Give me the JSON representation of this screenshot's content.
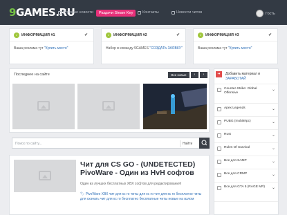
{
  "header": {
    "logo_num": "9",
    "logo_text": "GAMES.RU",
    "nav": [
      "Игровые новости",
      "Раздачи Steam Key",
      "Контакты",
      "Новости читов"
    ],
    "user": "Гость"
  },
  "info_cards": [
    {
      "title": "ИНФОРМАЦИЯ #1",
      "text": "Ваша реклама тут ",
      "link": "\"Купить место\""
    },
    {
      "title": "ИНФОРМАЦИЯ #2",
      "text": "Набор в команду 9GAMES ",
      "link": "\"СОЗДАТЬ ЗАЯВКУ\""
    },
    {
      "title": "ИНФОРМАЦИЯ #3",
      "text": "Ваша реклама тут ",
      "link": "\"Купить место\""
    }
  ],
  "recent": {
    "title": "Последнее на сайте",
    "more": "Все новые"
  },
  "search": {
    "placeholder": "Поиск по сайту...",
    "select": "Найти"
  },
  "article": {
    "title": "Чит для CS GO - (UNDETECTED) PivoWare - Один из HvH софтов",
    "desc": "Один из лучших бесплатных ХВХ софтов для редактирования!",
    "tags": "🏷 PivoWare ХВХ чит для кс го читы для кс го чит для кс го бесплатно читы для скачать чит для кс го бесплатно бесплатные читы новые на взлом"
  },
  "sidebar": {
    "add_title": "Добавить материал и",
    "add_link": "ЗАРАБОТАЙ",
    "categories": [
      "Counter-Strike: Global Offensive",
      "Apex Legends",
      "PUBG (mobile/pc)",
      "Rust",
      "Rules Of Survival",
      "Все для SAMP",
      "Все для CRMP",
      "Все для GTA 5 (RAGE MP)"
    ]
  }
}
